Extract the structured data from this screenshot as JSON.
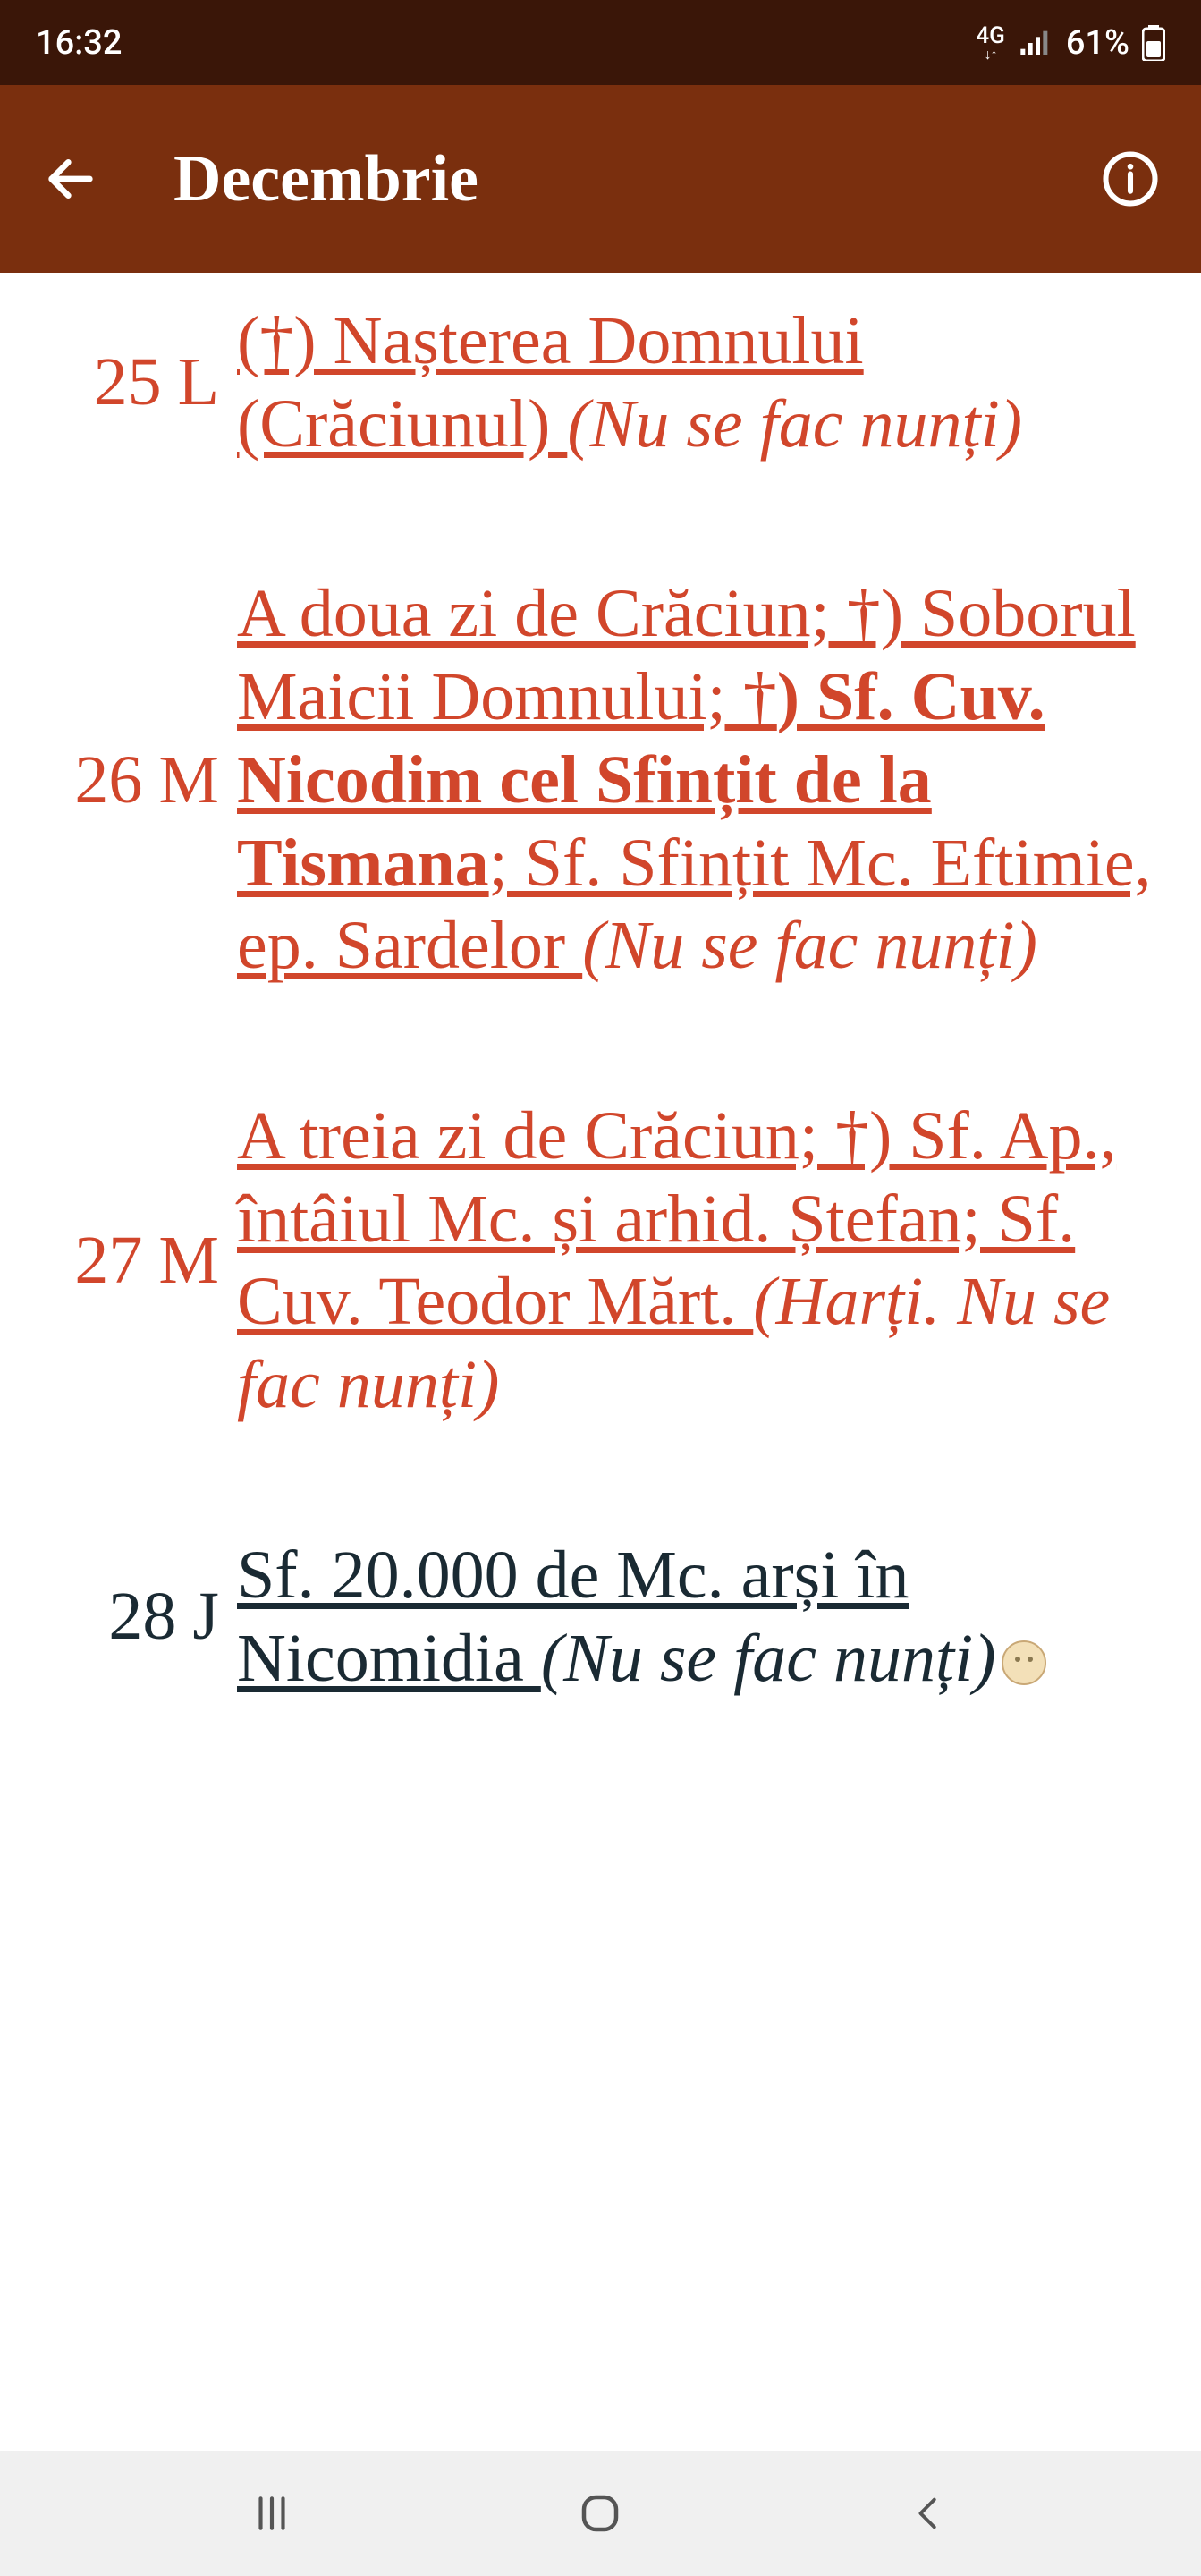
{
  "status": {
    "time": "16:32",
    "net": "4G",
    "battery": "61%"
  },
  "header": {
    "title": "Decembrie"
  },
  "rows": [
    {
      "num": "25",
      "dow": "L",
      "color": "red",
      "desc_color": "red",
      "parts": [
        {
          "t": "(†) Nașterea Domnului (Crăciunul) ",
          "link": true
        },
        {
          "t": "(Nu se fac nunți)",
          "italic": true
        }
      ]
    },
    {
      "num": "26",
      "dow": "M",
      "color": "red",
      "desc_color": "red",
      "parts": [
        {
          "t": "A doua zi de Crăciun; †) Soborul Maicii Domnului; †",
          "link": true
        },
        {
          "t": ") Sf. Cuv. Nicodim cel Sfințit de la Tismana",
          "link": true,
          "bold": true
        },
        {
          "t": "; Sf. Sfințit Mc. Eftimie, ep. Sardelor ",
          "link": true
        },
        {
          "t": "(Nu se fac nunți)",
          "italic": true
        }
      ]
    },
    {
      "num": "27",
      "dow": "M",
      "color": "red",
      "desc_color": "red",
      "parts": [
        {
          "t": "A treia zi de Crăciun; †) Sf. Ap., întâiul Mc. și arhid. Ștefan; Sf. Cuv. Teodor Mărt. ",
          "link": true
        },
        {
          "t": "(Harți. Nu se fac nunți)",
          "italic": true
        }
      ]
    },
    {
      "num": "28",
      "dow": "J",
      "color": "dark",
      "desc_color": "dark",
      "parts": [
        {
          "t": "Sf. 20.000 de Mc. arși în Nicomidia ",
          "link": true
        },
        {
          "t": "(Nu se fac nunți)",
          "italic": true
        },
        {
          "moon": true
        }
      ]
    }
  ]
}
